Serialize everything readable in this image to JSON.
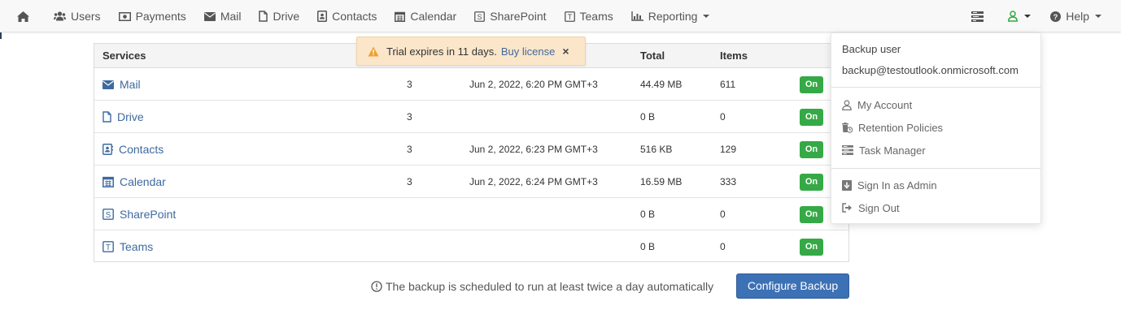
{
  "nav": {
    "items": [
      {
        "label": "Users",
        "icon": "users-icon"
      },
      {
        "label": "Payments",
        "icon": "payments-icon"
      },
      {
        "label": "Mail",
        "icon": "envelope-icon"
      },
      {
        "label": "Drive",
        "icon": "file-icon"
      },
      {
        "label": "Contacts",
        "icon": "contacts-icon"
      },
      {
        "label": "Calendar",
        "icon": "calendar-icon"
      },
      {
        "label": "SharePoint",
        "icon": "sharepoint-icon"
      },
      {
        "label": "Teams",
        "icon": "teams-icon"
      },
      {
        "label": "Reporting",
        "icon": "bar-chart-icon"
      }
    ],
    "help_label": "Help",
    "user_icon_color": "#35a946"
  },
  "alert": {
    "text": "Trial expires in 11 days.",
    "link": "Buy license",
    "close": "×",
    "icon_color": "#f0a030"
  },
  "table": {
    "headers": {
      "services": "Services",
      "total": "Total",
      "items": "Items"
    },
    "rows": [
      {
        "service": "Mail",
        "count": "3",
        "date": "Jun 2, 2022, 6:20 PM GMT+3",
        "total": "44.49 MB",
        "items": "611",
        "status": "On"
      },
      {
        "service": "Drive",
        "count": "3",
        "date": "",
        "total": "0 B",
        "items": "0",
        "status": "On"
      },
      {
        "service": "Contacts",
        "count": "3",
        "date": "Jun 2, 2022, 6:23 PM GMT+3",
        "total": "516 KB",
        "items": "129",
        "status": "On"
      },
      {
        "service": "Calendar",
        "count": "3",
        "date": "Jun 2, 2022, 6:24 PM GMT+3",
        "total": "16.59 MB",
        "items": "333",
        "status": "On"
      },
      {
        "service": "SharePoint",
        "count": "",
        "date": "",
        "total": "0 B",
        "items": "0",
        "status": "On"
      },
      {
        "service": "Teams",
        "count": "",
        "date": "",
        "total": "0 B",
        "items": "0",
        "status": "On"
      }
    ]
  },
  "footer": {
    "note": "The backup is scheduled to run at least twice a day automatically",
    "button": "Configure Backup"
  },
  "user_menu": {
    "name": "Backup user",
    "email": "backup@testoutlook.onmicrosoft.com",
    "items": [
      "My Account",
      "Retention Policies",
      "Task Manager"
    ],
    "admin_items": [
      "Sign In as Admin",
      "Sign Out"
    ]
  },
  "colors": {
    "accent": "#3d71b6",
    "link": "#3e6a9e",
    "status_on": "#35a946",
    "alert_bg": "#fbe6ca"
  }
}
